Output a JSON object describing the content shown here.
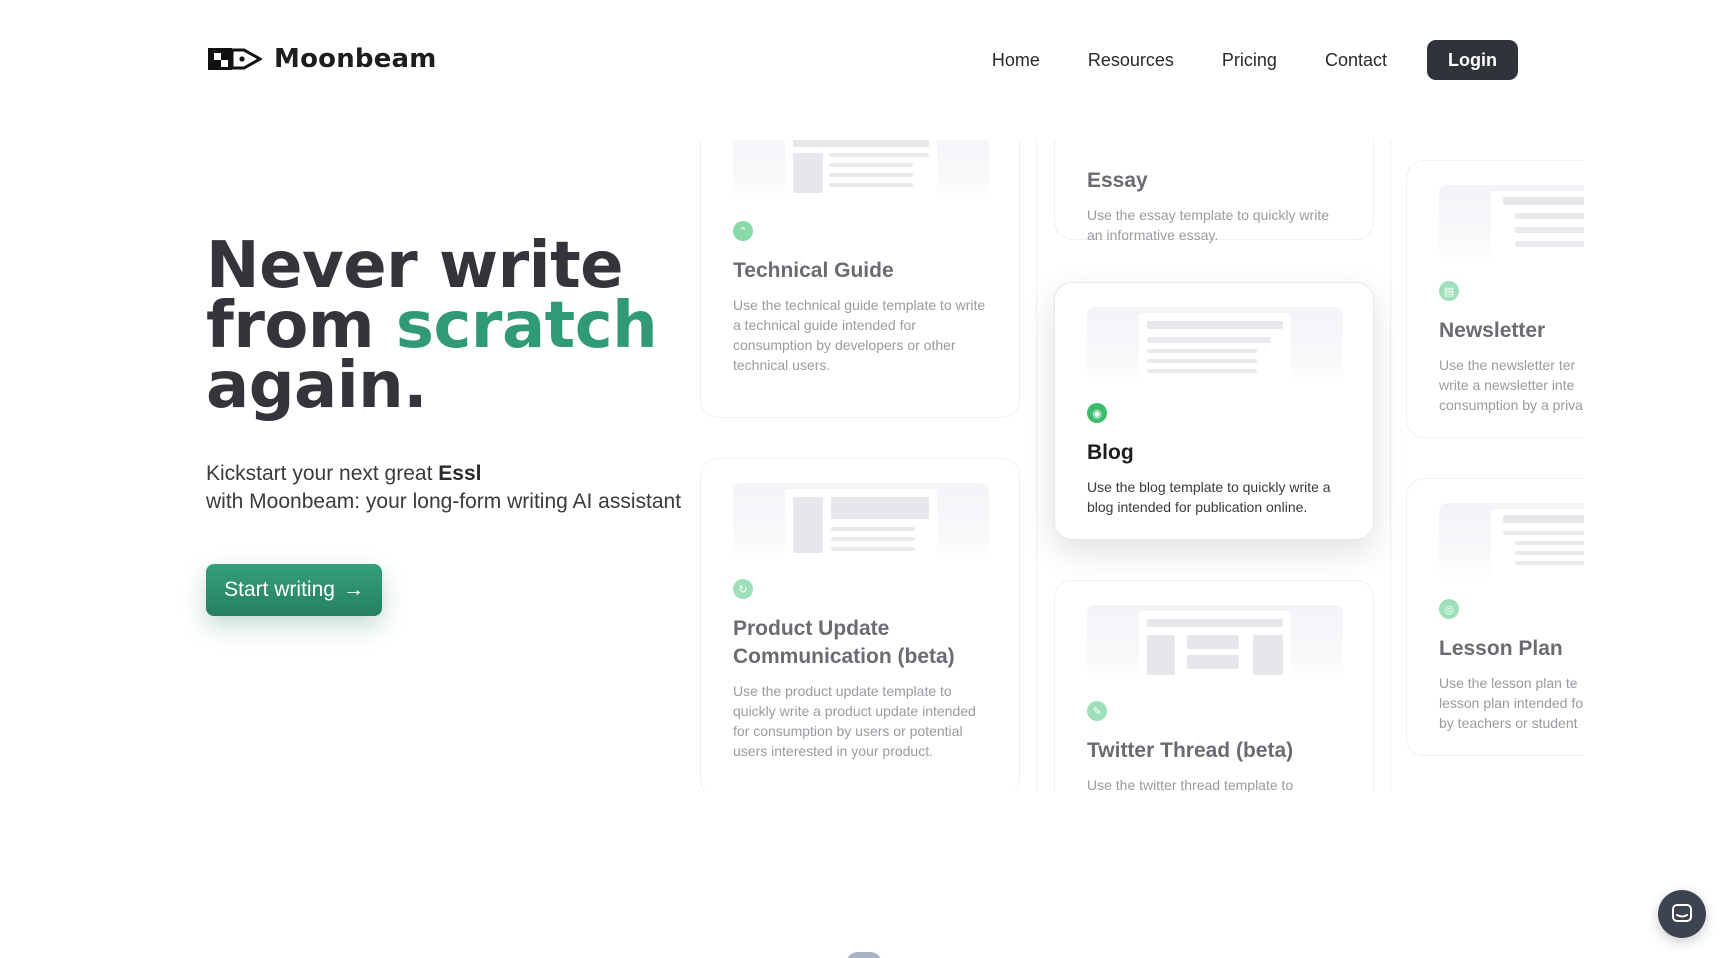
{
  "brand": {
    "name": "Moonbeam"
  },
  "nav": {
    "links": [
      "Home",
      "Resources",
      "Pricing",
      "Contact"
    ],
    "login_label": "Login"
  },
  "hero": {
    "title_line1": "Never write",
    "title_line2_prefix": "from ",
    "title_line2_accent": "scratch",
    "title_line3": "again.",
    "subtitle_prefix": "Kickstart your next great ",
    "subtitle_bold": "Essl",
    "subtitle_line2": "with Moonbeam: your long-form writing AI assistant",
    "cta_label": "Start writing",
    "cta_arrow": "→"
  },
  "colors": {
    "accent": "#2f9a75",
    "dark_button": "#2f3238",
    "icon_green": "#3dbd6c"
  },
  "cards": [
    {
      "title": "Technical Guide",
      "desc": "Use the technical guide template to write a technical guide intended for consumption by developers or other technical users.",
      "icon": "chevron-up-icon"
    },
    {
      "title": "Product Update Communication (beta)",
      "desc": "Use the product update template to quickly write a product update intended for consumption by users or potential users interested in your product.",
      "icon": "refresh-icon"
    },
    {
      "title": "Essay",
      "desc": "Use the essay template to quickly write an informative essay.",
      "icon": "document-icon"
    },
    {
      "title": "Blog",
      "desc": "Use the blog template to quickly write a blog intended for publication online.",
      "icon": "rss-icon"
    },
    {
      "title": "Twitter Thread (beta)",
      "desc": "Use the twitter thread template to",
      "icon": "chat-icon"
    },
    {
      "title": "Newsletter",
      "desc": "Use the newsletter ter write a newsletter inte consumption by a priva",
      "icon": "newsletter-icon"
    },
    {
      "title": "Lesson Plan",
      "desc": "Use the lesson plan te lesson plan intended fo by teachers or student",
      "icon": "target-icon"
    }
  ]
}
